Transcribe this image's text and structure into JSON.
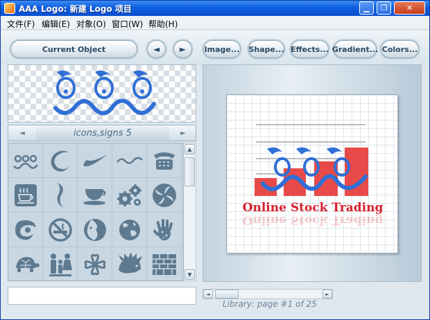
{
  "window": {
    "title": "AAA Logo: 新建 Logo 项目",
    "minimize": "▁",
    "restore": "❐",
    "close": "✕"
  },
  "menu": [
    "文件(F)",
    "编辑(E)",
    "对象(O)",
    "窗口(W)",
    "帮助(H)"
  ],
  "toolbar": {
    "current_object": "Current Object",
    "prev": "◄",
    "next": "►",
    "image": "Image...",
    "shape": "Shape...",
    "effects": "Effects...",
    "gradient": "Gradient...",
    "colors": "Colors..."
  },
  "library": {
    "category": "icons,signs 5",
    "prev": "◄",
    "next": "►",
    "icons": [
      "waves-eyes-icon",
      "swoosh-ring-icon",
      "swoosh-check-icon",
      "wave-line-icon",
      "telephone-icon",
      "coffee-icon",
      "s-curve-icon",
      "teacup-icon",
      "gears-icon",
      "pinwheel-icon",
      "spiral-icon",
      "no-smoking-icon",
      "moon-face-icon",
      "globe-icon",
      "handprint-icon",
      "turtle-icon",
      "family-icon",
      "clover-icon",
      "hedgehog-icon",
      "brick-wall-icon"
    ],
    "page_info": "Library: page #1 of 25"
  },
  "logo": {
    "text": "Online Stock Trading",
    "primary": "#2f6fd6",
    "accent": "#e84a4a",
    "text_color": "#d61f2c"
  },
  "colors": {
    "icon": "#5e7a90",
    "title": "#0a4fd0"
  }
}
